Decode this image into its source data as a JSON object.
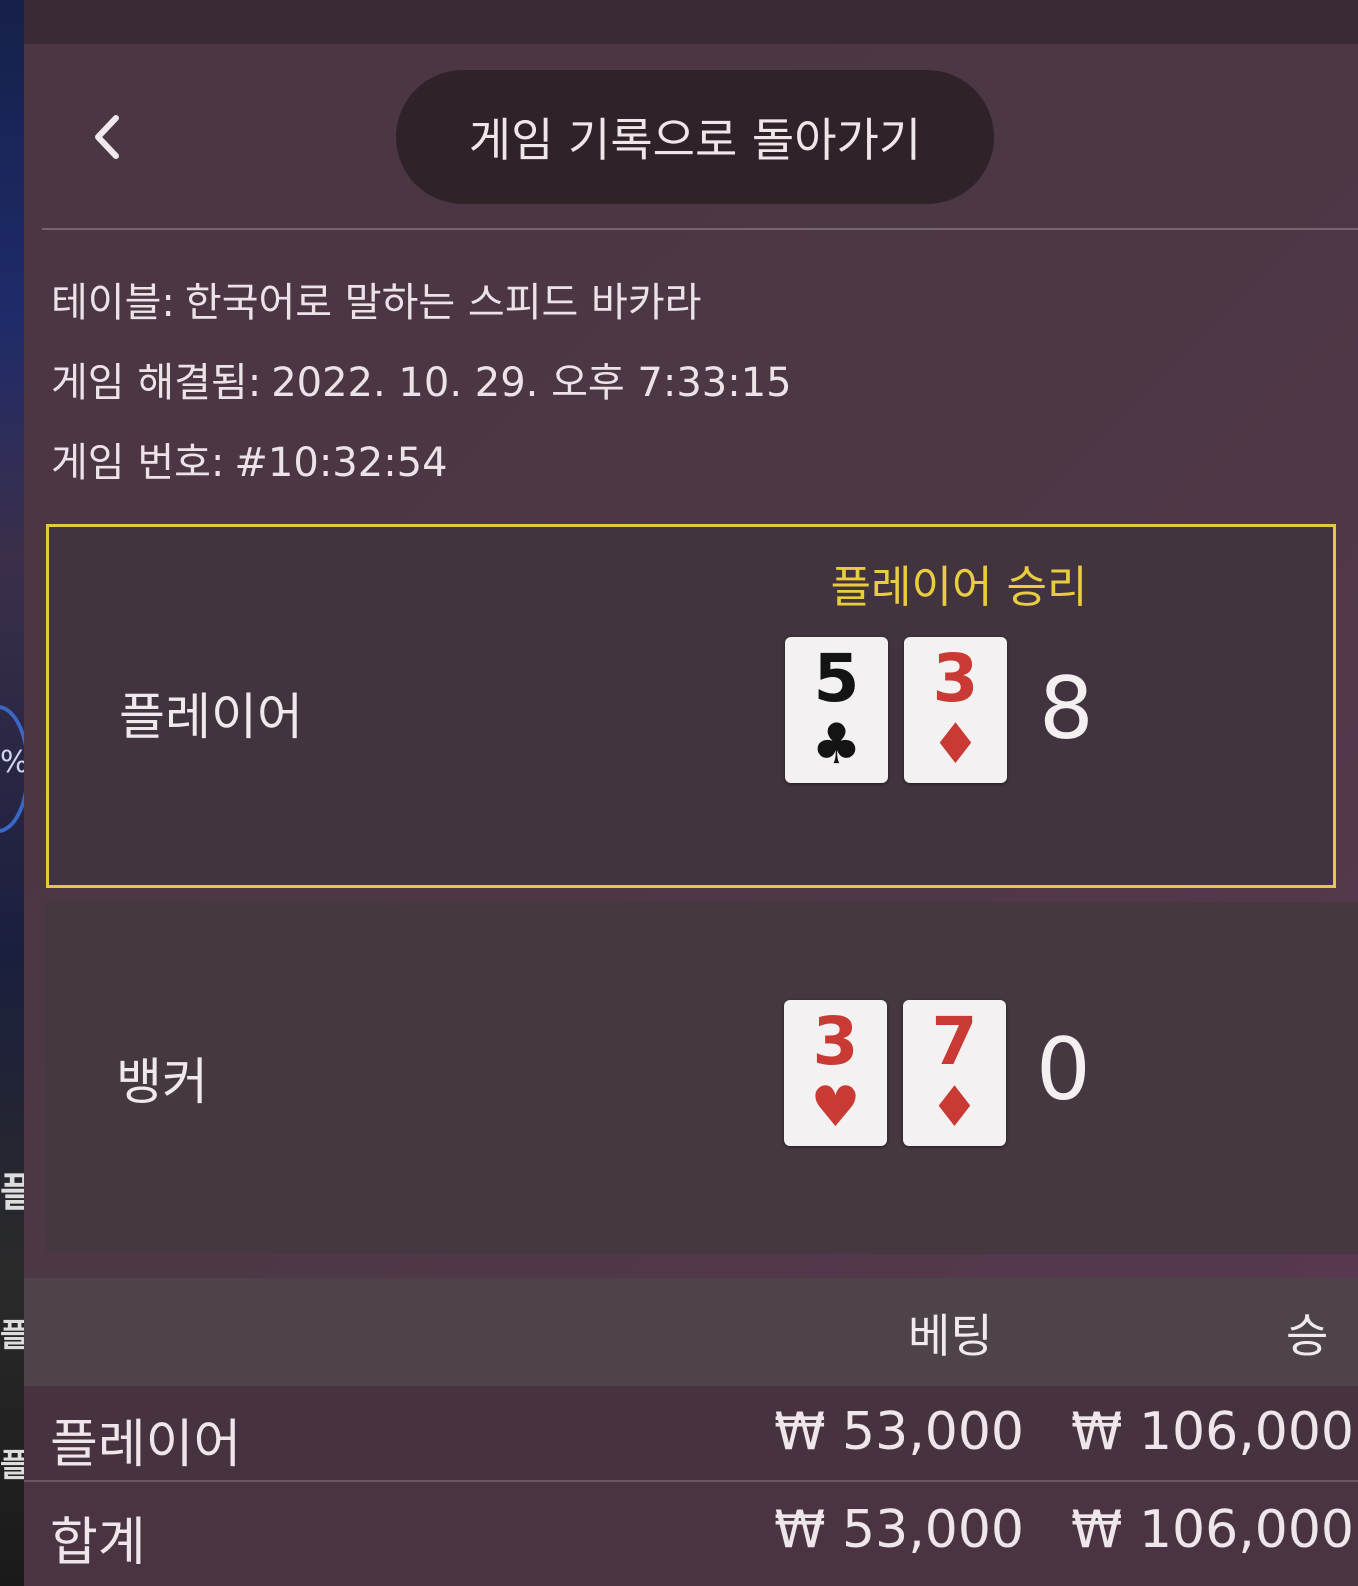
{
  "header": {
    "back_label": "게임 기록으로 돌아가기"
  },
  "info": {
    "table_label": "테이블:",
    "table_value": "한국어로 말하는 스피드 바카라",
    "resolved_label": "게임 해결됨:",
    "resolved_value": "2022. 10. 29. 오후 7:33:15",
    "game_no_label": "게임 번호:",
    "game_no_value": "#10:32:54"
  },
  "player": {
    "label": "플레이어",
    "result": "플레이어 승리",
    "cards": [
      {
        "rank": "5",
        "suit": "♣",
        "color": "#141414"
      },
      {
        "rank": "3",
        "suit": "♦",
        "color": "#c93a34"
      }
    ],
    "score": "8"
  },
  "banker": {
    "label": "뱅커",
    "cards": [
      {
        "rank": "3",
        "suit": "♥",
        "color": "#c93a34"
      },
      {
        "rank": "7",
        "suit": "♦",
        "color": "#c93a34"
      }
    ],
    "score": "0"
  },
  "bets": {
    "columns": [
      "베팅",
      "승"
    ],
    "rows": [
      {
        "name": "플레이어",
        "bet": "₩ 53,000",
        "win": "₩ 106,000"
      },
      {
        "name": "합계",
        "bet": "₩ 53,000",
        "win": "₩ 106,000"
      }
    ]
  },
  "colors": {
    "win_highlight": "#e6c93a",
    "red_suit": "#c93a34",
    "panel_bg": "#4b3643"
  }
}
